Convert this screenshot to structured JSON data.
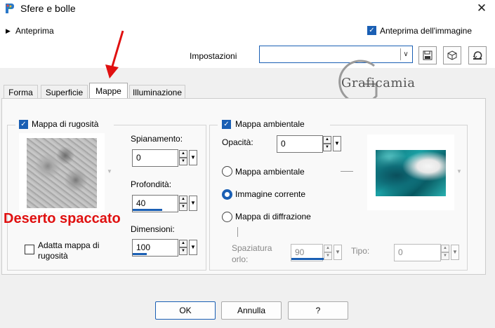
{
  "window": {
    "title": "Sfere e bolle",
    "close_glyph": "✕"
  },
  "header": {
    "preview_toggle_label": "Anteprima",
    "image_preview_label": "Anteprima dell'immagine",
    "image_preview_checked": true,
    "settings_label": "Impostazioni",
    "settings_value": ""
  },
  "watermark": {
    "text": "Graficamia"
  },
  "tabs": [
    {
      "label": "Forma",
      "active": false
    },
    {
      "label": "Superficie",
      "active": false
    },
    {
      "label": "Mappe",
      "active": true
    },
    {
      "label": "Illuminazione",
      "active": false
    }
  ],
  "bump_map": {
    "enabled_label": "Mappa di rugosità",
    "enabled": true,
    "smoothing_label": "Spianamento:",
    "smoothing_value": "0",
    "depth_label": "Profondità:",
    "depth_value": "40",
    "size_label": "Dimensioni:",
    "size_value": "100",
    "fit_label_line1": "Adatta mappa di",
    "fit_label_line2": "rugosità",
    "fit_checked": false,
    "annotation": "Deserto spaccato"
  },
  "env_map": {
    "enabled_label": "Mappa ambientale",
    "enabled": true,
    "opacity_label": "Opacità:",
    "opacity_value": "0",
    "options": [
      {
        "label": "Mappa ambientale",
        "selected": false
      },
      {
        "label": "Immagine corrente",
        "selected": true
      },
      {
        "label": "Mappa di diffrazione",
        "selected": false
      }
    ],
    "spacing_label_line1": "Spaziatura",
    "spacing_label_line2": "orlo:",
    "spacing_value": "90",
    "type_label": "Tipo:",
    "type_value": "0"
  },
  "footer": {
    "ok": "OK",
    "cancel": "Annulla",
    "help": "?"
  },
  "colors": {
    "accent": "#1a5fb4",
    "annotation": "#e01010"
  }
}
